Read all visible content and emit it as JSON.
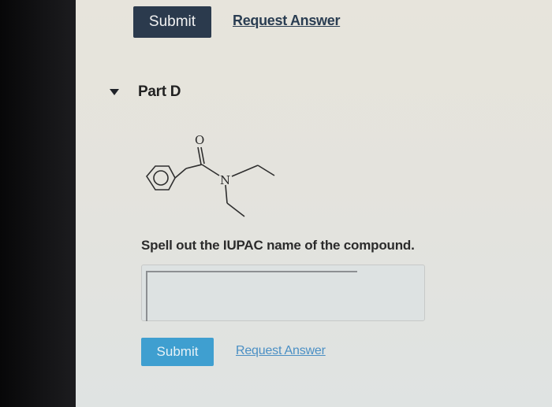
{
  "toolbar_top": {
    "submit_label": "Submit",
    "request_answer_label": "Request Answer"
  },
  "part": {
    "title": "Part D",
    "molecule": {
      "carbonyl_oxygen_label": "O",
      "nitrogen_label": "N"
    },
    "question": "Spell out the IUPAC name of the compound.",
    "answer": {
      "value": "",
      "placeholder": ""
    },
    "submit_label": "Submit",
    "request_answer_label": "Request Answer"
  },
  "colors": {
    "submit_top_bg": "#2b3a4d",
    "submit_bottom_bg": "#3f9fd0",
    "link_dark": "#2a3d52",
    "link_blue": "#4a8fc4"
  }
}
